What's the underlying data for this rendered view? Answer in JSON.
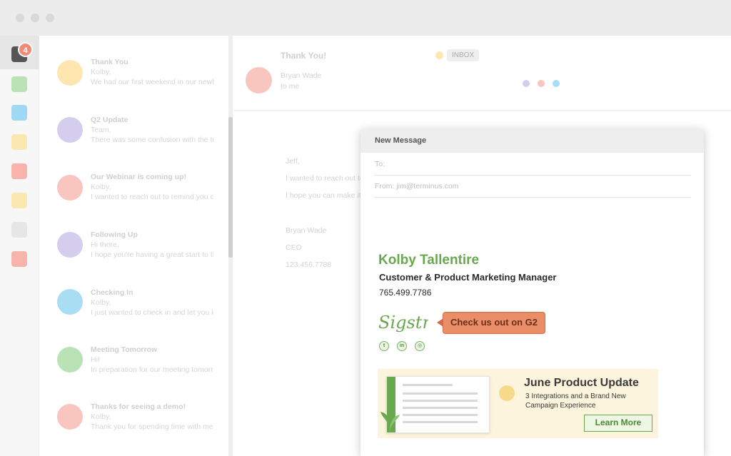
{
  "colors": {
    "accent_green": "#6aa84f",
    "cta_orange": "#ea8e6a",
    "badge": "#f28b73",
    "rail_icons": [
      "#555555",
      "#b9e3b5",
      "#9fd8f3",
      "#fbe7b0",
      "#f8b4aa",
      "#fbe7b0",
      "#e6e6e6",
      "#f8b4aa"
    ],
    "avatars": [
      "#fde6b0",
      "#d4cdee",
      "#f8c6bf",
      "#d4cdee",
      "#a8ddf3",
      "#b9e3b5",
      "#f8c6bf"
    ]
  },
  "rail": {
    "badge_count": "4"
  },
  "messages": [
    {
      "subject": "Thank You",
      "line1": "Kolby,",
      "line2": "We had our first weekend in our newly"
    },
    {
      "subject": "Q2 Update",
      "line1": "Team,",
      "line2": "There was some confusion with the ti"
    },
    {
      "subject": "Our Webinar is coming up!",
      "line1": "Kolby,",
      "line2": "I wanted to reach out to remind you o"
    },
    {
      "subject": "Following Up",
      "line1": "Hi there,",
      "line2": "I hope you're having a great start to th"
    },
    {
      "subject": "Checking In",
      "line1": "Kolby,",
      "line2": "I just wanted to check in and let you k"
    },
    {
      "subject": "Meeting Tomorrow",
      "line1": "Hi!",
      "line2": "In preparation for our meeting tomorr"
    },
    {
      "subject": "Thanks for seeing a demo!",
      "line1": "Kolby,",
      "line2": "Thank you for spending time with me"
    }
  ],
  "reader": {
    "subject": "Thank You!",
    "label": "INBOX",
    "from": "Bryan Wade",
    "to": "to me",
    "body": [
      "Jeff,",
      "I wanted to reach out to",
      "I hope you can make it!",
      "Bryan Wade",
      "CEO",
      "123.456.7788"
    ],
    "dot_colors": [
      "#d4cdee",
      "#f8c6bf",
      "#a8ddf3"
    ]
  },
  "compose": {
    "title": "New Message",
    "to_placeholder": "To:",
    "from_text": "From: jim@terminus.com"
  },
  "signature": {
    "name": "Kolby Tallentire",
    "title": "Customer & Product Marketing Manager",
    "phone": "765.499.7786",
    "logo_text": "Sigstr",
    "g2_cta": "Check us out on G2",
    "social": [
      "twitter-icon",
      "linkedin-icon",
      "instagram-icon"
    ]
  },
  "banner": {
    "title": "June Product Update",
    "subtitle1": "3 Integrations and a Brand New",
    "subtitle2": "Campaign Experience",
    "cta": "Learn More"
  }
}
